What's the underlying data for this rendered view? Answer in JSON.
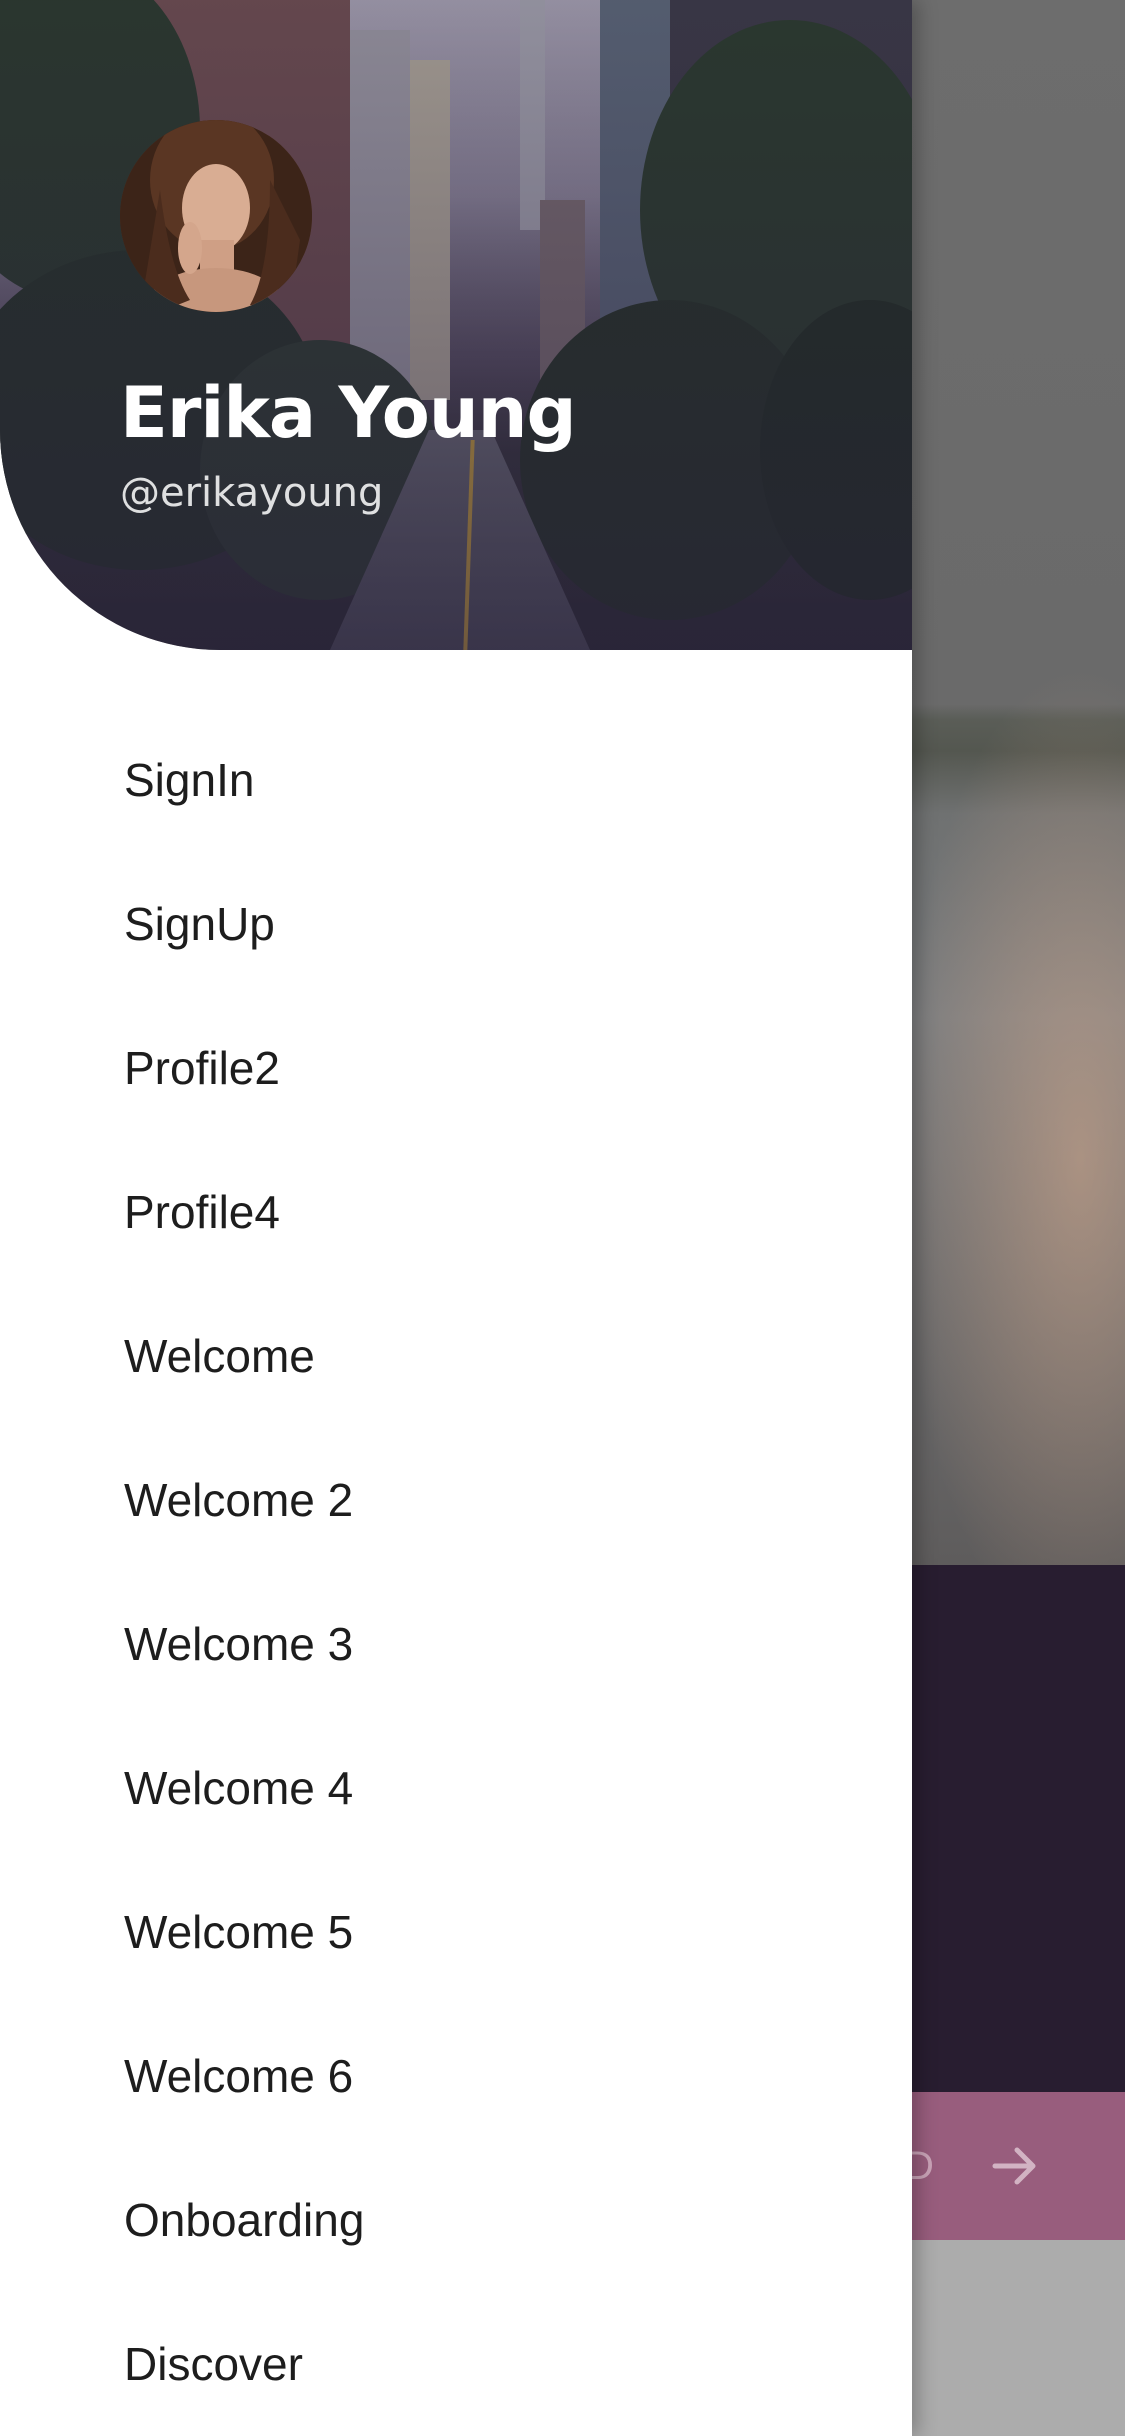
{
  "background": {
    "cta_label": "D",
    "cta_icon": "arrow-right-icon",
    "colors": {
      "dark_panel": "#281d30",
      "cta": "#985d7d"
    }
  },
  "drawer": {
    "user": {
      "name": "Erika Young",
      "handle": "@erikayoung",
      "avatar": "avatar-photo"
    },
    "menu": [
      {
        "label": "SignIn"
      },
      {
        "label": "SignUp"
      },
      {
        "label": "Profile2"
      },
      {
        "label": "Profile4"
      },
      {
        "label": "Welcome"
      },
      {
        "label": "Welcome 2"
      },
      {
        "label": "Welcome 3"
      },
      {
        "label": "Welcome 4"
      },
      {
        "label": "Welcome 5"
      },
      {
        "label": "Welcome 6"
      },
      {
        "label": "Onboarding"
      },
      {
        "label": "Discover"
      }
    ]
  }
}
